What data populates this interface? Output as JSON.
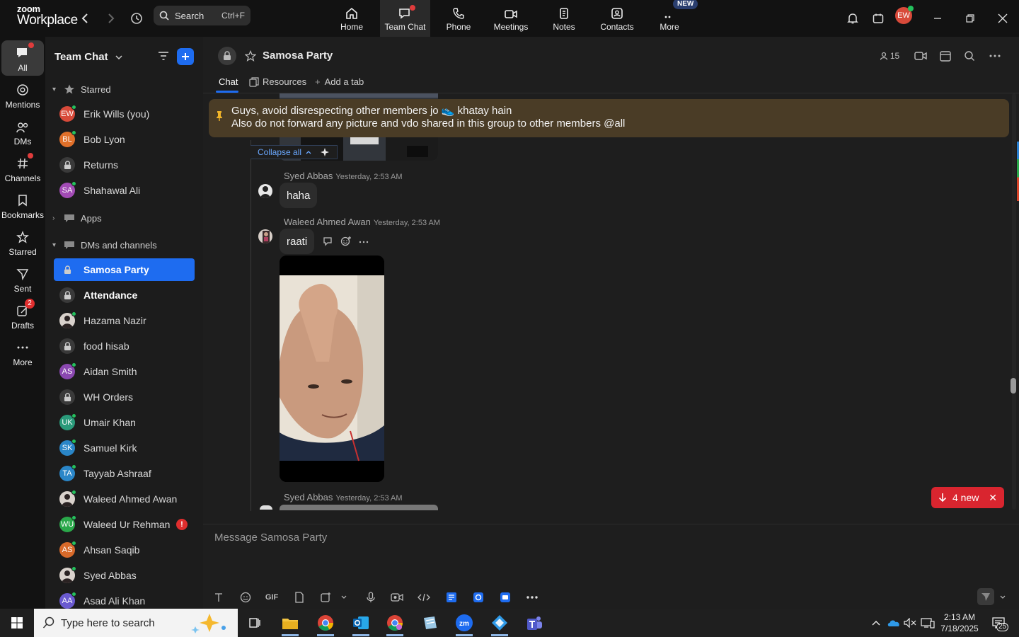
{
  "app": {
    "brand_line1": "zoom",
    "brand_line2": "Workplace"
  },
  "topbar": {
    "search_label": "Search",
    "search_shortcut": "Ctrl+F",
    "nav": [
      {
        "label": "Home",
        "icon": "home-icon"
      },
      {
        "label": "Team Chat",
        "icon": "chat-icon",
        "active": true
      },
      {
        "label": "Phone",
        "icon": "phone-icon"
      },
      {
        "label": "Meetings",
        "icon": "video-icon"
      },
      {
        "label": "Notes",
        "icon": "notes-icon"
      },
      {
        "label": "Contacts",
        "icon": "contacts-icon"
      },
      {
        "label": "More",
        "icon": "more-icon",
        "badge": "NEW"
      }
    ],
    "user_initials": "EW"
  },
  "rail": [
    {
      "label": "All",
      "active": true
    },
    {
      "label": "Mentions"
    },
    {
      "label": "DMs"
    },
    {
      "label": "Channels"
    },
    {
      "label": "Bookmarks"
    },
    {
      "label": "Starred"
    },
    {
      "label": "Sent"
    },
    {
      "label": "Drafts",
      "badge": "2"
    },
    {
      "label": "More"
    }
  ],
  "sidebar": {
    "title": "Team Chat",
    "sections": {
      "starred": "Starred",
      "apps": "Apps",
      "dms": "DMs and channels"
    },
    "starred": [
      {
        "name": "Erik Wills (you)",
        "initials": "EW",
        "color": "#d84a3a"
      },
      {
        "name": "Bob Lyon",
        "initials": "BL",
        "color": "#e0702a"
      },
      {
        "name": "Returns",
        "lock": true
      },
      {
        "name": "Shahawal Ali",
        "initials": "SA",
        "color": "#a24bb5"
      }
    ],
    "dms": [
      {
        "name": "Samosa Party",
        "lock": true,
        "selected": true
      },
      {
        "name": "Attendance",
        "lock": true,
        "bold": true
      },
      {
        "name": "Hazama Nazir",
        "photo": true
      },
      {
        "name": "food hisab",
        "lock": true
      },
      {
        "name": "Aidan Smith",
        "initials": "AS",
        "color": "#8a48b0"
      },
      {
        "name": "WH Orders",
        "lock": true
      },
      {
        "name": "Umair Khan",
        "initials": "UK",
        "color": "#2a9a7a"
      },
      {
        "name": "Samuel Kirk",
        "initials": "SK",
        "color": "#2a86c8"
      },
      {
        "name": "Tayyab Ashraaf",
        "initials": "TA",
        "color": "#2a86c8"
      },
      {
        "name": "Waleed Ahmed Awan",
        "photo": true
      },
      {
        "name": "Waleed Ur Rehman",
        "initials": "WU",
        "color": "#2aa84a",
        "alert": "!"
      },
      {
        "name": "Ahsan Saqib",
        "initials": "AS",
        "color": "#d86a2a"
      },
      {
        "name": "Syed Abbas",
        "photo": true
      },
      {
        "name": "Asad Ali Khan",
        "initials": "AA",
        "color": "#6a5ad0"
      }
    ]
  },
  "channel": {
    "name": "Samosa Party",
    "member_count": "15",
    "tabs": {
      "chat": "Chat",
      "resources": "Resources",
      "add": "Add a tab"
    },
    "pinned_line1": "Guys, avoid disrespecting other members jo 👟 khatay hain",
    "pinned_line2": "Also do not forward any picture and vdo shared in this group to other members @all",
    "collapse_label": "Collapse all",
    "messages": [
      {
        "sender": "Syed Abbas",
        "time": "Yesterday, 2:53 AM",
        "text": "haha"
      },
      {
        "sender": "Waleed Ahmed Awan",
        "time": "Yesterday, 2:53 AM",
        "text": "raati"
      },
      {
        "sender": "Syed Abbas",
        "time": "Yesterday, 2:53 AM"
      }
    ],
    "new_pill": "4 new",
    "composer_placeholder": "Message Samosa Party"
  },
  "taskbar": {
    "search_placeholder": "Type here to search",
    "time": "2:13 AM",
    "date": "7/18/2025",
    "notif_count": "25"
  }
}
